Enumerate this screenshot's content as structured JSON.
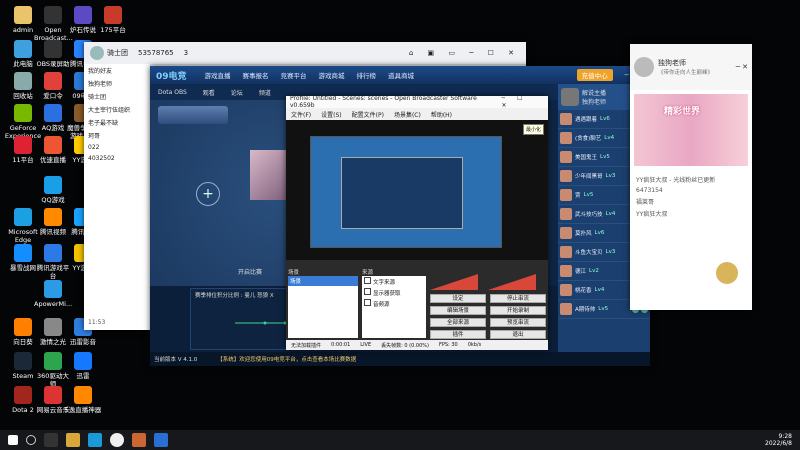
{
  "desktop_icons": [
    {
      "label": "admin",
      "color": "#e9c46a"
    },
    {
      "label": "Open Broadcast...",
      "color": "#333"
    },
    {
      "label": "炉石传说",
      "color": "#5a4ac4"
    },
    {
      "label": "175平台",
      "color": "#c83a2a"
    },
    {
      "label": "此电脑",
      "color": "#3fa0e0"
    },
    {
      "label": "OBS录屏助",
      "color": "#333"
    },
    {
      "label": "腾讯会议",
      "color": "#2a84ff"
    },
    {
      "label": "回收站",
      "color": "#8aa"
    },
    {
      "label": "爱口令",
      "color": "#e0413a"
    },
    {
      "label": "09电竞",
      "color": "#2a7ad8"
    },
    {
      "label": "GeForce Experience",
      "color": "#77b900"
    },
    {
      "label": "AQ游戏",
      "color": "#2a70e0"
    },
    {
      "label": "魔兽争霸III游戏平台",
      "color": "#8a5a2a"
    },
    {
      "label": "11平台",
      "color": "#d23"
    },
    {
      "label": "优速直播",
      "color": "#e53"
    },
    {
      "label": "YY游戏",
      "color": "#ffcc00"
    },
    {
      "label": "QQ游戏",
      "color": "#1b9ee8"
    },
    {
      "label": "Microsoft Edge",
      "color": "#1ba1e2"
    },
    {
      "label": "腾讯视频",
      "color": "#ff8a00"
    },
    {
      "label": "腾讯QQ",
      "color": "#1aa3ff"
    },
    {
      "label": "暴雪战网",
      "color": "#148eff"
    },
    {
      "label": "腾讯游戏平台",
      "color": "#2d7ae6"
    },
    {
      "label": "YY游戏",
      "color": "#f4c400"
    },
    {
      "label": "ApowerMi...",
      "color": "#2b9be6"
    },
    {
      "label": "向日葵",
      "color": "#ff7f00"
    },
    {
      "label": "激情之光",
      "color": "#888"
    },
    {
      "label": "迅雷影音",
      "color": "#2f7de1"
    },
    {
      "label": "Steam",
      "color": "#1b2838"
    },
    {
      "label": "360驱动大师",
      "color": "#2da44e"
    },
    {
      "label": "迅雷",
      "color": "#1677ff"
    },
    {
      "label": "Dota 2",
      "color": "#a2261c"
    },
    {
      "label": "网易云音乐",
      "color": "#d33"
    },
    {
      "label": "5逸直播神器",
      "color": "#f80"
    }
  ],
  "qq_window": {
    "group_name": "骑士团",
    "group_id": "53578765",
    "member_count": "3",
    "tree": [
      "我的好友",
      "独狗老师",
      "骑士团",
      "大主宰行伍组织",
      "老子最不缺",
      "珂哥",
      "022",
      "4032502"
    ],
    "bottom_status": "11:53"
  },
  "game_app": {
    "logo": "09电竞",
    "nav": [
      "游戏直播",
      "赛事报名",
      "竞赛平台",
      "游戏商城",
      "排行榜",
      "道具商城"
    ],
    "tabs": [
      "Dota OBS",
      "观看",
      "论坛",
      "频道"
    ],
    "bottom_text": "当前版本 V 4.1.0",
    "ticker": "【系统】欢迎您使用09电竞平台，点击查看本场比赛数据",
    "chart_title": "赛季排位积分比例 : 曼儿 怒狼 X",
    "start_label": "开始比赛",
    "checkbox": "开启比赛",
    "top_button": "充值中心",
    "streamer_label": "解说主播",
    "streamer_name": "独狗老师",
    "members": [
      {
        "name": "遇遇跟着",
        "lv": "Lv6"
      },
      {
        "name": "(贪食)聊艺",
        "lv": "Lv4"
      },
      {
        "name": "美国鬼王",
        "lv": "Lv5"
      },
      {
        "name": "少年闻黑哥",
        "lv": "Lv3"
      },
      {
        "name": "贾",
        "lv": "Lv5"
      },
      {
        "name": "武斗技巧技",
        "lv": "Lv4"
      },
      {
        "name": "莫扑风",
        "lv": "Lv6"
      },
      {
        "name": "斗鱼大宝贝",
        "lv": "Lv3"
      },
      {
        "name": "德江",
        "lv": "Lv2"
      },
      {
        "name": "桃花香",
        "lv": "Lv4"
      },
      {
        "name": "A期待帅",
        "lv": "Lv5"
      }
    ]
  },
  "obs_window": {
    "title": "Profile: Untitled - Scenes: scenes - Open Broadcaster Software v0.659b",
    "menu": [
      "文件(F)",
      "设置(S)",
      "配置文件(P)",
      "场景集(C)",
      "帮助(H)"
    ],
    "scenes_label": "场景",
    "scenes": [
      "场景"
    ],
    "sources_label": "来源",
    "sources": [
      "文字来源",
      "显示器获取",
      "音频源"
    ],
    "buttons": [
      "设定",
      "停止串流",
      "编辑场景",
      "开始录制",
      "全部来源",
      "预览串流",
      "插件",
      "退出"
    ],
    "status": [
      "无法加载插件",
      "0:00:01",
      "LIVE",
      "丢失帧数: 0 (0.00%)",
      "FPS: 30",
      "0kb/s"
    ],
    "tooltip": "最小化"
  },
  "chat_window": {
    "name": "独狗老师",
    "subtitle": "《带你走向人生巅峰》",
    "banner": "精彩世界",
    "messages": [
      "YY疯狂大叔 - 光线粉丝已更新",
      "6473154",
      "福莱哥",
      "YY疯狂大叔"
    ]
  },
  "taskbar": {
    "time": "9:28",
    "date": "2022/6/8"
  }
}
